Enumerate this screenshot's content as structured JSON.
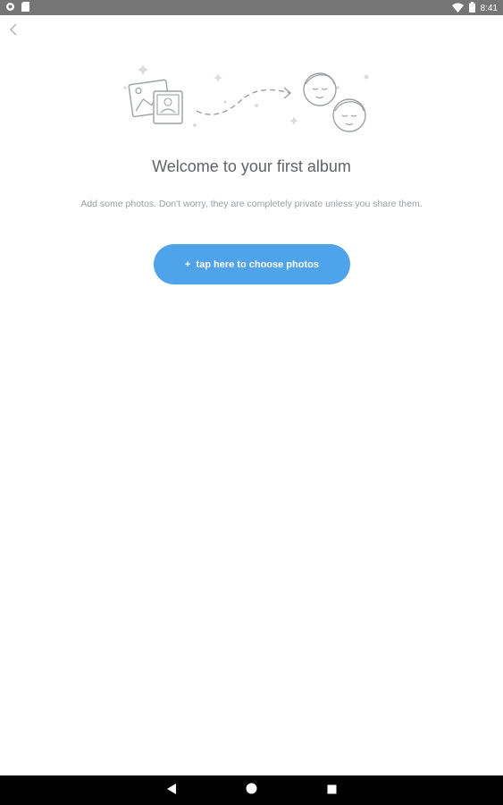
{
  "status_bar": {
    "time": "8:41",
    "icons_left": [
      "notification-icon",
      "sd-card-icon"
    ],
    "icons_right": [
      "wifi-icon",
      "battery-icon"
    ]
  },
  "header": {
    "back_icon": "chevron-left-icon"
  },
  "empty_state": {
    "illustration": "photos-to-faces-illustration",
    "title": "Welcome to your first album",
    "subtitle": "Add some photos. Don't worry, they are completely private unless you share them.",
    "button_icon": "+",
    "button_label": "tap here to choose photos"
  },
  "colors": {
    "status_bar": "#757575",
    "accent_button": "#4fa3ea",
    "title_text": "#5f6368",
    "subtitle_text": "#9aa0a6",
    "nav_bar": "#000000"
  },
  "nav_bar": {
    "buttons": [
      "back-triangle-icon",
      "home-circle-icon",
      "recents-square-icon"
    ]
  }
}
